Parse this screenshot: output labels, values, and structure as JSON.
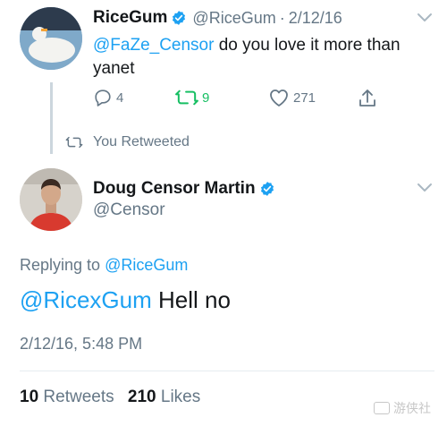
{
  "tweet": {
    "display_name": "RiceGum",
    "handle": "@RiceGum",
    "separator": "·",
    "date": "2/12/16",
    "text_mention": "@FaZe_Censor",
    "text_body": " do you love it more than yanet",
    "replies": "4",
    "retweets": "9",
    "likes": "271"
  },
  "retweet_banner": "You Retweeted",
  "reply": {
    "display_name": "Doug Censor Martin",
    "handle": "@Censor",
    "replying_prefix": "Replying to ",
    "replying_to": "@RiceGum",
    "text_mention": "@RicexGum",
    "text_body": " Hell no",
    "timestamp": "2/12/16, 5:48 PM",
    "retweet_count": "10",
    "retweet_label": "Retweets",
    "like_count": "210",
    "like_label": "Likes"
  },
  "watermark": "游侠社",
  "colors": {
    "accent": "#1da1f2",
    "retweet_green": "#17bf63",
    "muted": "#657786"
  },
  "icons": [
    "verified-badge-icon",
    "chevron-down-icon",
    "reply-icon",
    "retweet-icon",
    "heart-icon",
    "share-icon"
  ]
}
